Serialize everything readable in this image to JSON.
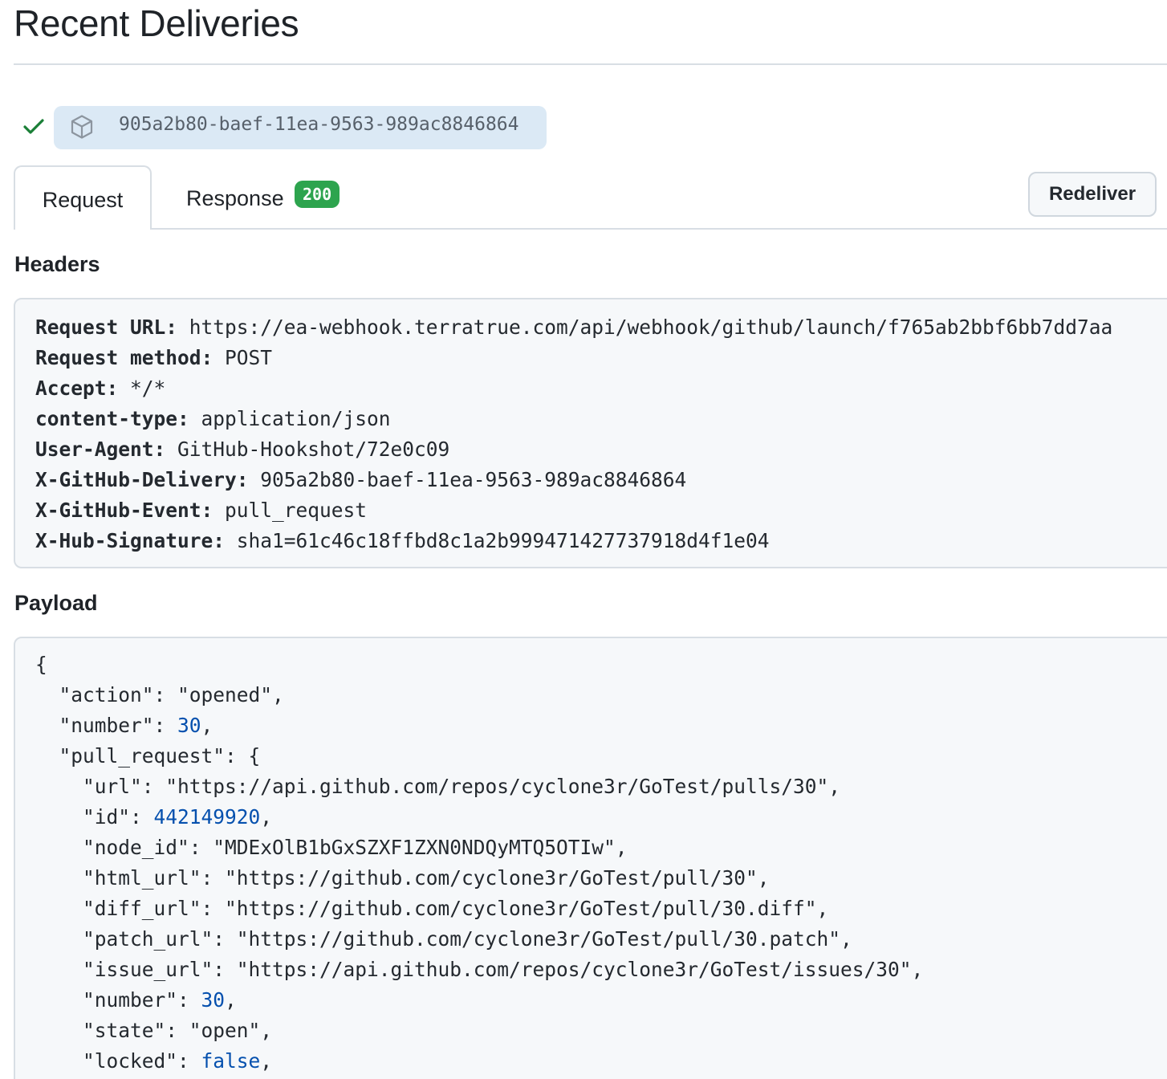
{
  "page": {
    "title": "Recent Deliveries"
  },
  "delivery": {
    "status_icon": "check-icon",
    "type_icon": "package-icon",
    "guid": "905a2b80-baef-11ea-9563-989ac8846864"
  },
  "tabs": {
    "request_label": "Request",
    "response_label": "Response",
    "response_status": "200"
  },
  "actions": {
    "redeliver_label": "Redeliver"
  },
  "headers": {
    "heading": "Headers",
    "items": [
      {
        "key": "Request URL:",
        "value": " https://ea-webhook.terratrue.com/api/webhook/github/launch/f765ab2bbf6bb7dd7aa"
      },
      {
        "key": "Request method:",
        "value": " POST"
      },
      {
        "key": "Accept:",
        "value": " */*"
      },
      {
        "key": "content-type:",
        "value": " application/json"
      },
      {
        "key": "User-Agent:",
        "value": " GitHub-Hookshot/72e0c09"
      },
      {
        "key": "X-GitHub-Delivery:",
        "value": " 905a2b80-baef-11ea-9563-989ac8846864"
      },
      {
        "key": "X-GitHub-Event:",
        "value": " pull_request"
      },
      {
        "key": "X-Hub-Signature:",
        "value": " sha1=61c46c18ffbd8c1a2b999471427737918d4f1e04"
      }
    ]
  },
  "payload": {
    "heading": "Payload",
    "lines": [
      {
        "text": "{",
        "value": "",
        "suffix": ""
      },
      {
        "text": "  \"action\": \"opened\",",
        "value": "",
        "suffix": ""
      },
      {
        "text": "  \"number\": ",
        "value": "30",
        "suffix": ","
      },
      {
        "text": "  \"pull_request\": {",
        "value": "",
        "suffix": ""
      },
      {
        "text": "    \"url\": \"https://api.github.com/repos/cyclone3r/GoTest/pulls/30\",",
        "value": "",
        "suffix": ""
      },
      {
        "text": "    \"id\": ",
        "value": "442149920",
        "suffix": ","
      },
      {
        "text": "    \"node_id\": \"MDExOlB1bGxSZXF1ZXN0NDQyMTQ5OTIw\",",
        "value": "",
        "suffix": ""
      },
      {
        "text": "    \"html_url\": \"https://github.com/cyclone3r/GoTest/pull/30\",",
        "value": "",
        "suffix": ""
      },
      {
        "text": "    \"diff_url\": \"https://github.com/cyclone3r/GoTest/pull/30.diff\",",
        "value": "",
        "suffix": ""
      },
      {
        "text": "    \"patch_url\": \"https://github.com/cyclone3r/GoTest/pull/30.patch\",",
        "value": "",
        "suffix": ""
      },
      {
        "text": "    \"issue_url\": \"https://api.github.com/repos/cyclone3r/GoTest/issues/30\",",
        "value": "",
        "suffix": ""
      },
      {
        "text": "    \"number\": ",
        "value": "30",
        "suffix": ","
      },
      {
        "text": "    \"state\": \"open\",",
        "value": "",
        "suffix": ""
      },
      {
        "text": "    \"locked\": ",
        "value": "false",
        "suffix": ","
      }
    ]
  }
}
